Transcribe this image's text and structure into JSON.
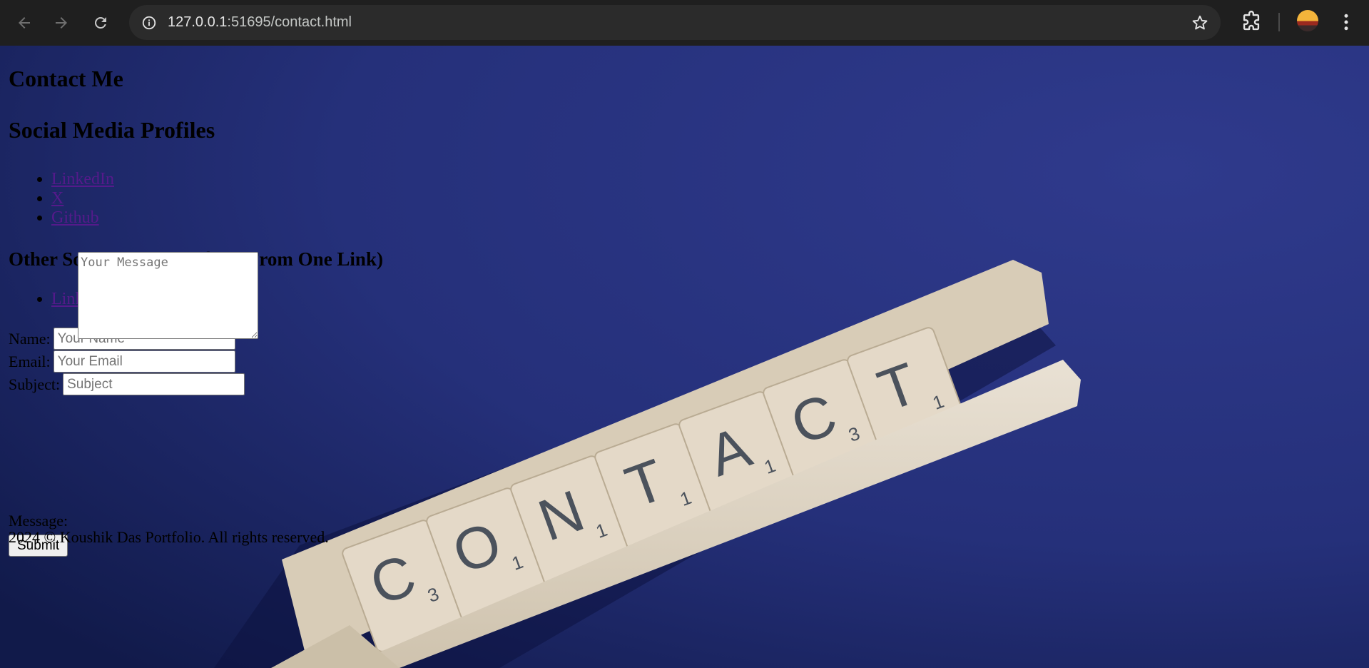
{
  "browser": {
    "url_host": "127.0.0.1",
    "url_path": ":51695/contact.html",
    "back_icon": "arrow-left-icon",
    "forward_icon": "arrow-right-icon",
    "reload_icon": "reload-icon",
    "site_info_icon": "info-icon",
    "bookmark_icon": "star-icon",
    "extensions_icon": "puzzle-icon",
    "menu_icon": "vertical-dots-icon"
  },
  "page": {
    "title": "Contact Me",
    "social_heading": "Social Media Profiles",
    "social_links": [
      "LinkedIn",
      "X",
      "Github"
    ],
    "other_heading": "Other Social Media Profiles (From One Link)",
    "other_links": [
      "Linktree"
    ],
    "form": {
      "name_label": "Name:",
      "name_placeholder": "Your Name",
      "email_label": "Email:",
      "email_placeholder": "Your Email",
      "subject_label": "Subject:",
      "subject_placeholder": "Subject",
      "message_label": "Message:",
      "message_placeholder": "Your Message",
      "submit_label": "Submit"
    },
    "footer": "2024 © Koushik Das Portfolio. All rights reserved.",
    "background_tiles": [
      {
        "letter": "C",
        "score": "3"
      },
      {
        "letter": "O",
        "score": "1"
      },
      {
        "letter": "N",
        "score": "1"
      },
      {
        "letter": "T",
        "score": "1"
      },
      {
        "letter": "A",
        "score": "1"
      },
      {
        "letter": "C",
        "score": "3"
      },
      {
        "letter": "T",
        "score": "1"
      }
    ]
  },
  "colors": {
    "chrome_bg": "#1f1f1f",
    "omnibox_bg": "#2b2b2b",
    "page_bg": "#27307a",
    "link": "#551a8b",
    "tile": "#e4d9c8"
  }
}
